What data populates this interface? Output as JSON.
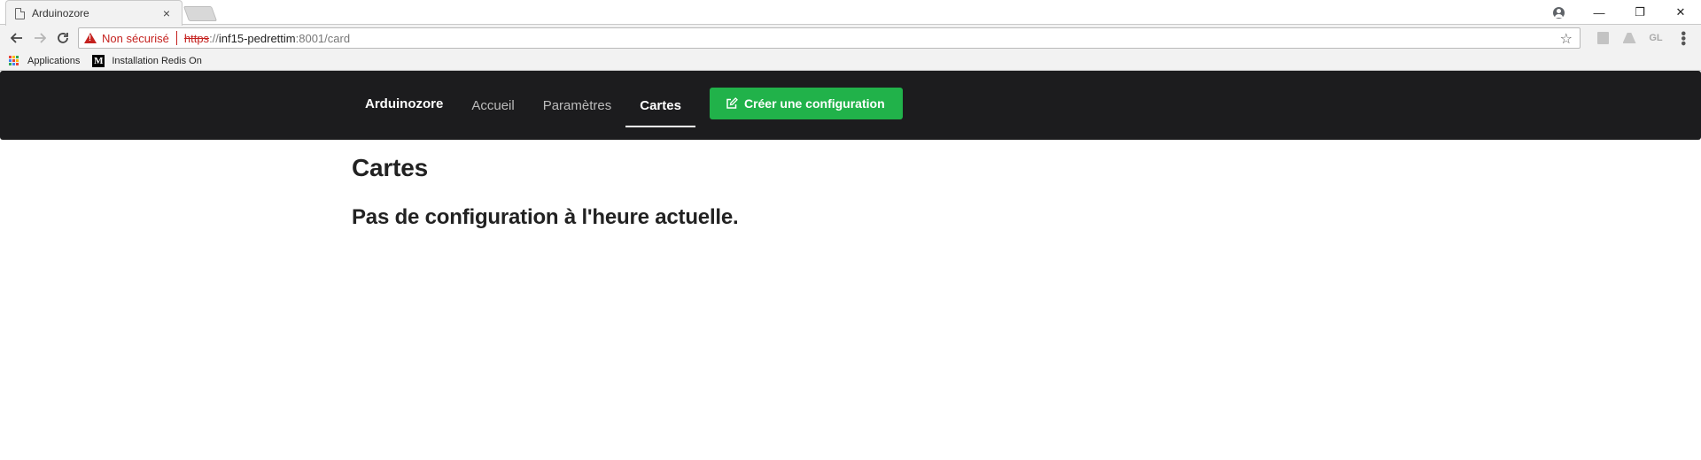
{
  "browser": {
    "tab_title": "Arduinozore",
    "tab_close": "×",
    "security_label": "Non sécurisé",
    "url_scheme": "https",
    "url_scheme_sep": "://",
    "url_host": "inf15-pedrettim",
    "url_path": ":8001/card",
    "extension_label": "GL",
    "bookmarks": [
      {
        "label": "Applications",
        "icon": "apps-icon"
      },
      {
        "label": "Installation Redis On",
        "icon": "medium-icon",
        "icon_text": "M"
      }
    ],
    "window_controls": {
      "minimize": "—",
      "restore": "❐",
      "close": "✕"
    },
    "colors": {
      "not_secure": "#c5221f"
    }
  },
  "navbar": {
    "brand": "Arduinozore",
    "links": [
      {
        "label": "Accueil",
        "active": false
      },
      {
        "label": "Paramètres",
        "active": false
      },
      {
        "label": "Cartes",
        "active": true
      }
    ],
    "cta_label": "Créer une configuration",
    "colors": {
      "background": "#1c1c1e",
      "cta": "#21b24a"
    }
  },
  "main": {
    "title": "Cartes",
    "empty_message": "Pas de configuration à l'heure actuelle."
  }
}
